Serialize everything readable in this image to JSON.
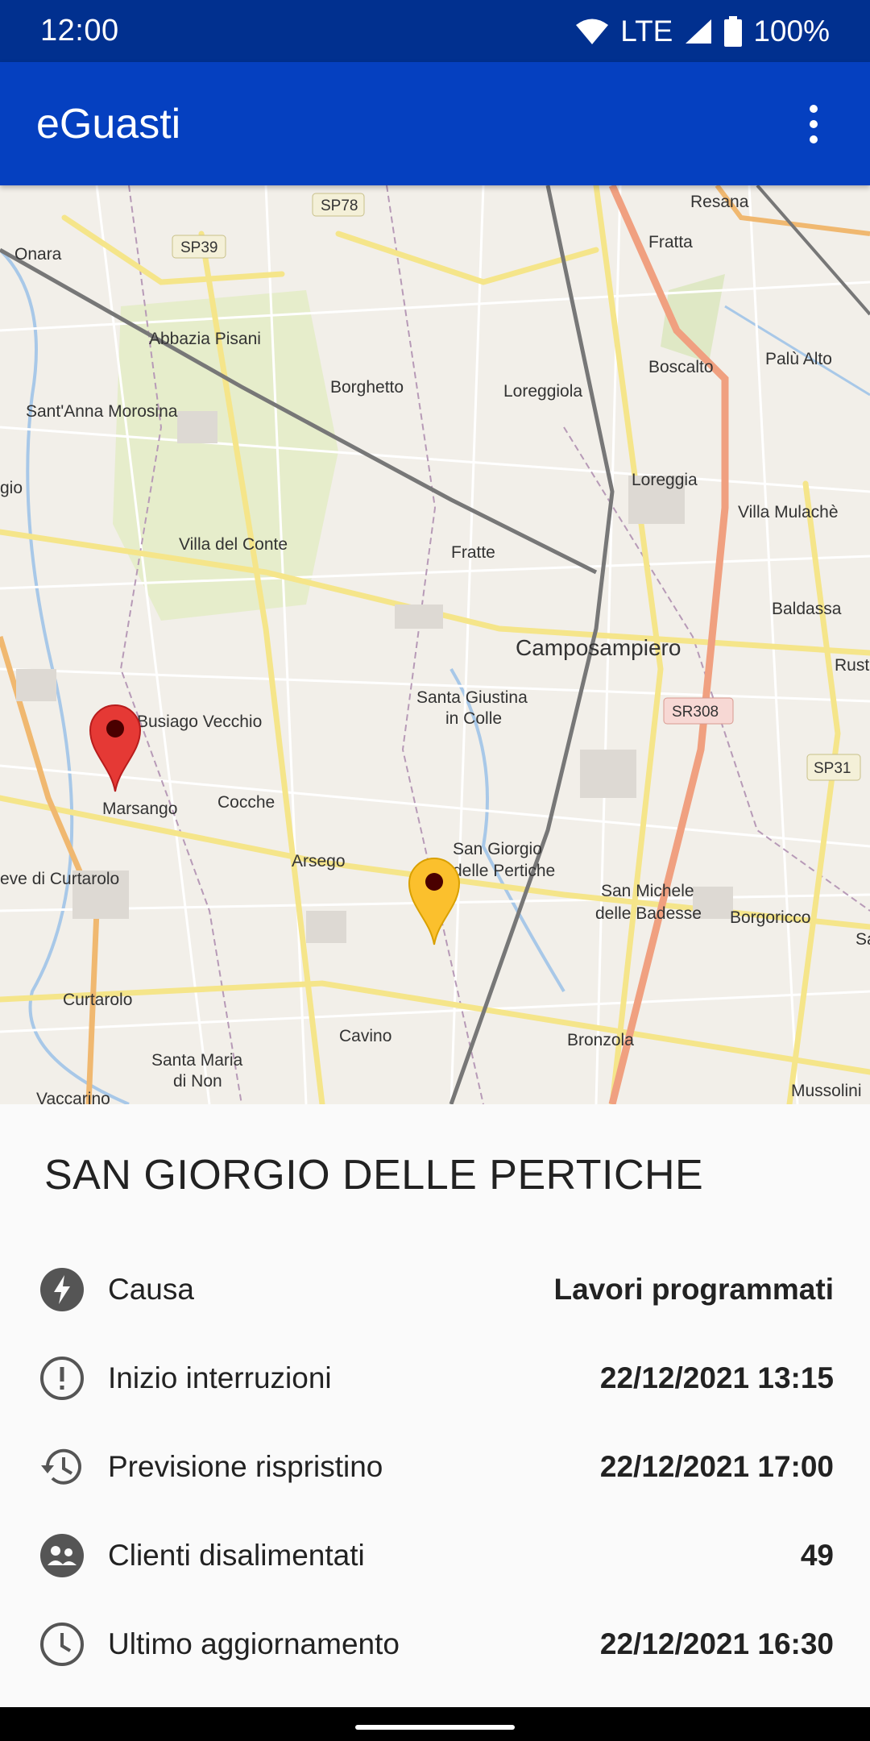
{
  "status": {
    "time": "12:00",
    "network": "LTE",
    "battery": "100%"
  },
  "app_bar": {
    "title": "eGuasti"
  },
  "map": {
    "labels": {
      "resana": "Resana",
      "fratta": "Fratta",
      "onara": "Onara",
      "sp39": "SP39",
      "sp78": "SP78",
      "abbazia": "Abbazia Pisani",
      "borghetto": "Borghetto",
      "loreggiola": "Loreggiola",
      "boscalto": "Boscalto",
      "palu": "Palù Alto",
      "santanna": "Sant'Anna Morosina",
      "loreggia": "Loreggia",
      "villamulache": "Villa Mulachè",
      "villaconte": "Villa del Conte",
      "fratte": "Fratte",
      "baldassa": "Baldassa",
      "camposampiero": "Camposampiero",
      "rustega": "Rustega",
      "santagiustina1": "Santa Giustina",
      "santagiustina2": "in Colle",
      "sr308": "SR308",
      "sp31": "SP31",
      "busiago": "Busiago Vecchio",
      "marsango": "Marsango",
      "cocche": "Cocche",
      "arsego": "Arsego",
      "sangiorgio1": "San Giorgio",
      "sangiorgio2": "delle Pertiche",
      "sanmichele1": "San Michele",
      "sanmichele2": "delle Badesse",
      "borgoricco": "Borgoricco",
      "curtarolo_pieve": "eve di Curtarolo",
      "curtarolo": "Curtarolo",
      "cavino": "Cavino",
      "bronzola": "Bronzola",
      "santamaria1": "Santa Maria",
      "santamaria2": "di Non",
      "vaccarino": "Vaccarino",
      "mussolini": "Mussolini",
      "gio": "gio",
      "sa": "Sa"
    },
    "pins": [
      {
        "name": "red-pin",
        "color": "#e53935"
      },
      {
        "name": "yellow-pin",
        "color": "#fbc02d"
      }
    ]
  },
  "details": {
    "place": "SAN GIORGIO DELLE PERTICHE",
    "rows": [
      {
        "icon": "bolt-icon",
        "label": "Causa",
        "value": "Lavori programmati"
      },
      {
        "icon": "alert-icon",
        "label": "Inizio interruzioni",
        "value": "22/12/2021 13:15"
      },
      {
        "icon": "history-icon",
        "label": "Previsione rispristino",
        "value": "22/12/2021 17:00"
      },
      {
        "icon": "people-icon",
        "label": "Clienti disalimentati",
        "value": "49"
      },
      {
        "icon": "clock-icon",
        "label": "Ultimo aggiornamento",
        "value": "22/12/2021 16:30"
      }
    ]
  },
  "colors": {
    "status_bar": "#01308f",
    "app_bar": "#0540c0",
    "accent_road": "#f0a080"
  }
}
